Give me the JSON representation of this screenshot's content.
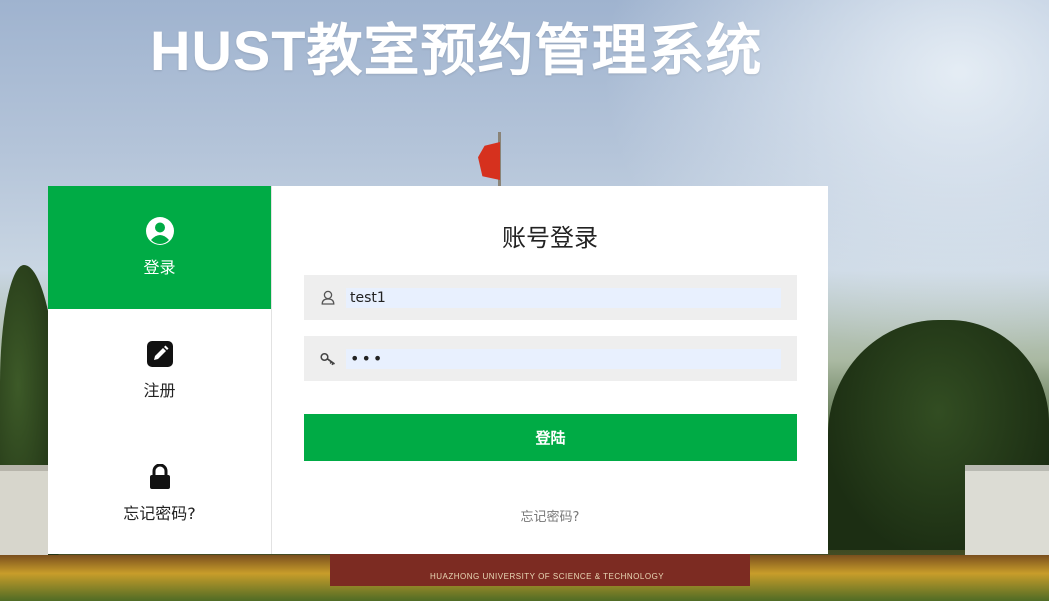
{
  "header": {
    "title": "HUST教室预约管理系统"
  },
  "background": {
    "stone_caption": "HUAZHONG UNIVERSITY OF SCIENCE & TECHNOLOGY"
  },
  "side_nav": {
    "items": [
      {
        "label": "登录",
        "icon": "user-circle-icon",
        "active": true
      },
      {
        "label": "注册",
        "icon": "pencil-icon",
        "active": false
      },
      {
        "label": "忘记密码?",
        "icon": "lock-icon",
        "active": false
      }
    ]
  },
  "login_form": {
    "title": "账号登录",
    "username": {
      "value": "test1",
      "icon": "user-icon"
    },
    "password": {
      "value": "•••",
      "icon": "key-icon"
    },
    "submit_label": "登陆",
    "forgot_label": "忘记密码?"
  },
  "colors": {
    "accent": "#00ab45",
    "field_bg": "#eeeeee",
    "autofill_bg": "#e8f0fe"
  }
}
